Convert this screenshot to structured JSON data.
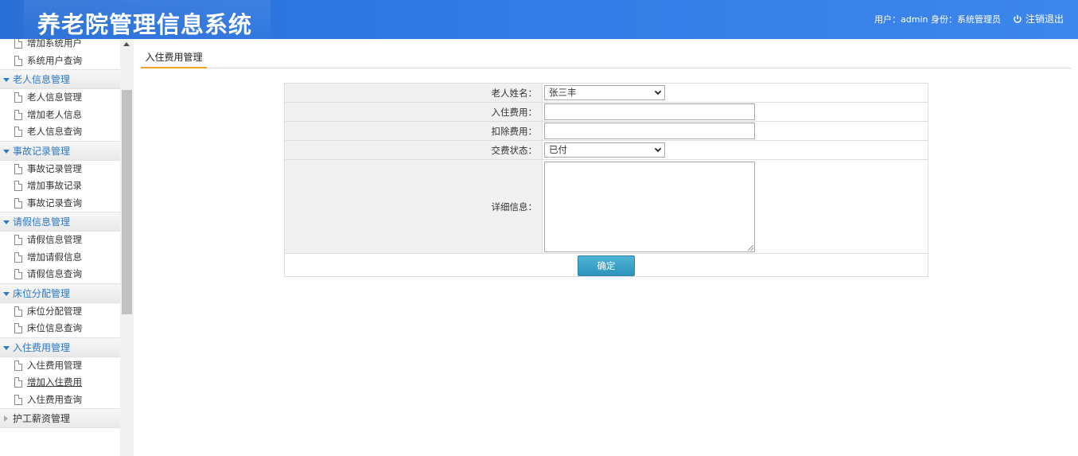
{
  "header": {
    "title": "养老院管理信息系统",
    "user_info": "用户：admin 身份：系统管理员",
    "logout_label": "注销退出"
  },
  "sidebar": {
    "top_items": [
      "增加系统用户",
      "系统用户查询"
    ],
    "groups": [
      {
        "title": "老人信息管理",
        "items": [
          "老人信息管理",
          "增加老人信息",
          "老人信息查询"
        ]
      },
      {
        "title": "事故记录管理",
        "items": [
          "事故记录管理",
          "增加事故记录",
          "事故记录查询"
        ]
      },
      {
        "title": "请假信息管理",
        "items": [
          "请假信息管理",
          "增加请假信息",
          "请假信息查询"
        ]
      },
      {
        "title": "床位分配管理",
        "items": [
          "床位分配管理",
          "床位信息查询"
        ]
      },
      {
        "title": "入住费用管理",
        "items": [
          "入住费用管理",
          "增加入住费用",
          "入住费用查询"
        ]
      },
      {
        "title": "护工薪资管理",
        "items": []
      }
    ]
  },
  "main": {
    "tab_label": "入住费用管理",
    "form": {
      "elder_name_label": "老人姓名：",
      "elder_name_value": "张三丰",
      "checkin_fee_label": "入住费用：",
      "checkin_fee_value": "",
      "deduct_fee_label": "扣除费用：",
      "deduct_fee_value": "",
      "pay_status_label": "交费状态：",
      "pay_status_value": "已付",
      "detail_label": "详细信息：",
      "detail_value": "",
      "submit_label": "确定"
    }
  }
}
